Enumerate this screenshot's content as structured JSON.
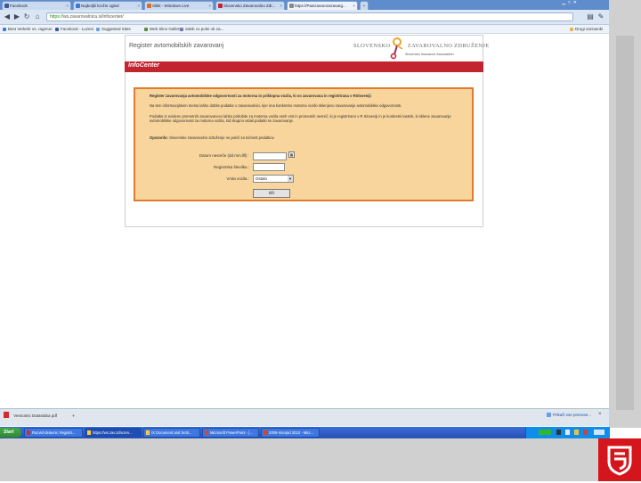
{
  "browser": {
    "tabs": [
      {
        "label": "Facebook",
        "color": "#3b5998"
      },
      {
        "label": "Najboljši krožni ogled",
        "color": "#3a7ad6"
      },
      {
        "label": "Slikit - Windows Live",
        "color": "#e66a1a"
      },
      {
        "label": "Slovensko Zavarovalno Zdr...",
        "color": "#c3252f"
      },
      {
        "label": "https://Pasizavarozazavarg...",
        "color": "#888888"
      }
    ],
    "url_scheme": "https://",
    "url_rest": "ws.zavarovalnica.si/infocenter/",
    "bookmarks": [
      {
        "label": "Best Verkehr vs. ragerun",
        "color": "#3a7ad6"
      },
      {
        "label": "Facebook - Luzeni",
        "color": "#3b5998"
      },
      {
        "label": "Suggested Sites",
        "color": "#6aa0e0"
      },
      {
        "label": "Web Slice Gallery",
        "color": "#5a8a3a"
      },
      {
        "label": "Sdeb zo polni ob za...",
        "color": "#7777aa"
      }
    ],
    "other_bookmarks": "Drugi zaznamki"
  },
  "page": {
    "register_title": "Register avtomobilskih zavarovanj",
    "logo_name_part1": "SLOVENSKO",
    "logo_name_part2": "ZAVAROVALNO",
    "logo_name_part3": "ZDRUŽENJE",
    "logo_subtitle": "Slovenian Insurance Association",
    "info_label": "InfoCenter",
    "panel_heading": "Register zavarovanja avtomobilske odgovornosti za motorna in priklopna vozila, ki so zavarovana in registrirana v RSloveniji",
    "para1": "Na tem informacijskem mestu lahko dobite podatke o zavarovalnici, kjer ima konkretno motorno vozilo sklenjeno zavarovanje avtomobilske odgovornosti.",
    "para2": "Podatke iz evidenc prometnih zavarovancev lahko pridobite za motorna vozila vseh vrst in prometnih nesreč, ki je registrirano v R Sloveniji in je konkretni lastnik, ki sklene zavarovanje avtomobilske odgovornosti za motorna vozila, kid skupno ostali podatki se zavarovanje.",
    "note_label": "Opozorilo:",
    "note_text": "Slovensko zavarovalno združenje ne jamči za točnost podatkov.",
    "form": {
      "date_label": "Datum nesreče (dd.mm.llll) :",
      "plate_label": "Registrska številka :",
      "vehicle_label": "Vrsta vozila :",
      "vehicle_value": "Ostalo",
      "submit_label": "Išči"
    }
  },
  "download": {
    "file": "Vesnotnic Datastaba pdf",
    "show_all": "Prikaži vse prenose..."
  },
  "taskbar": {
    "start": "Start",
    "tasks": [
      {
        "label": "Razvid-delavnic Registri...",
        "color": "#d72a2a"
      },
      {
        "label": "https://ws.zav.zdruzen...",
        "color": "#ffcc33"
      },
      {
        "label": "IX Document and Setti...",
        "color": "#ffcc33"
      },
      {
        "label": "Microsoft PowerPoint - [...",
        "color": "#d24726"
      },
      {
        "label": "2009-Interpid 2010 - Micr...",
        "color": "#d24726"
      }
    ]
  }
}
